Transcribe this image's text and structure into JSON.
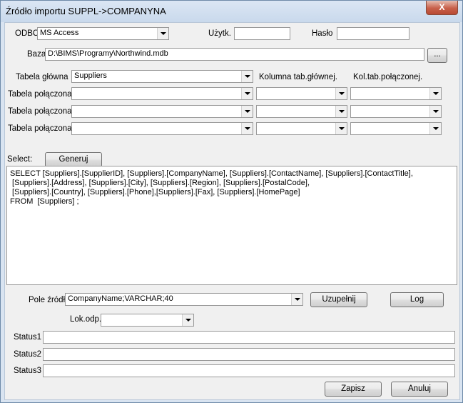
{
  "window": {
    "title": "Źródło importu SUPPL->COMPANYNA",
    "close_label": "X"
  },
  "connection": {
    "odbc_label": "ODBC",
    "odbc_value": "MS Access",
    "user_label": "Użytk.",
    "user_value": "",
    "password_label": "Hasło",
    "password_value": "",
    "base_label": "Baza",
    "base_value": "D:\\BIMS\\Programy\\Northwind.mdb",
    "browse_label": "..."
  },
  "tables": {
    "main_label": "Tabela główna",
    "main_value": "Suppliers",
    "col_main_header": "Kolumna tab.głównej.",
    "col_joined_header": "Kol.tab.połączonej.",
    "joined_rows": [
      {
        "label": "Tabela połączona",
        "table": "",
        "col_main": "",
        "col_joined": ""
      },
      {
        "label": "Tabela połączona",
        "table": "",
        "col_main": "",
        "col_joined": ""
      },
      {
        "label": "Tabela połączona",
        "table": "",
        "col_main": "",
        "col_joined": ""
      }
    ]
  },
  "select": {
    "label": "Select:",
    "generate_label": "Generuj",
    "sql_text": "SELECT [Suppliers].[SupplierID], [Suppliers].[CompanyName], [Suppliers].[ContactName], [Suppliers].[ContactTitle],\n [Suppliers].[Address], [Suppliers].[City], [Suppliers].[Region], [Suppliers].[PostalCode],\n [Suppliers].[Country], [Suppliers].[Phone],[Suppliers].[Fax], [Suppliers].[HomePage]\nFROM  [Suppliers] ;"
  },
  "source": {
    "field_label": "Pole źródł",
    "field_value": "CompanyName;VARCHAR;40",
    "fill_label": "Uzupełnij",
    "log_label": "Log",
    "lok_label": "Lok.odp.",
    "lok_value": ""
  },
  "status": [
    {
      "label": "Status1",
      "value": ""
    },
    {
      "label": "Status2",
      "value": ""
    },
    {
      "label": "Status3",
      "value": ""
    }
  ],
  "footer": {
    "save_label": "Zapisz",
    "cancel_label": "Anuluj"
  }
}
